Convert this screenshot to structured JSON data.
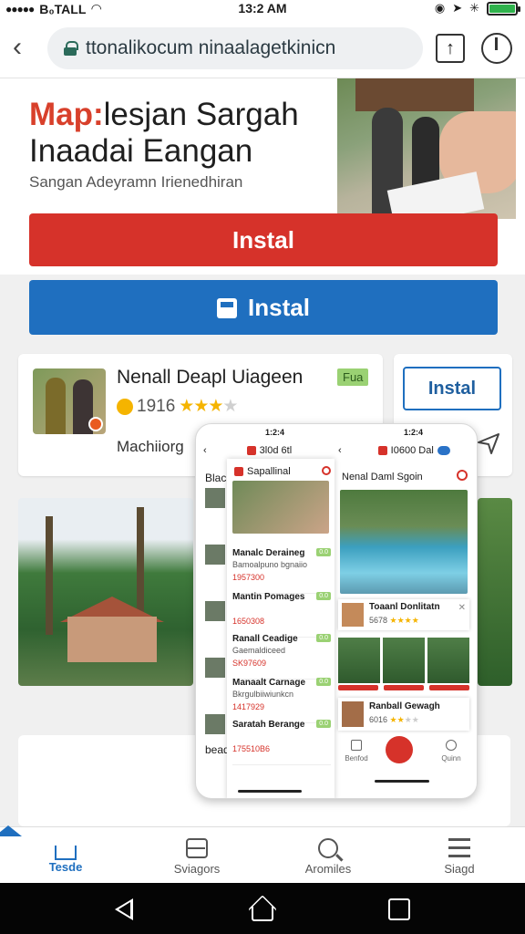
{
  "status_bar": {
    "carrier": "B₀TALL",
    "time": "13:2 AM",
    "battery_level": 1.0,
    "colors": {
      "battery": "#2fb24c"
    }
  },
  "browser": {
    "url": "ttonalikocum ninaalagetkinicn",
    "icons": [
      "back-arrow-icon",
      "lock-icon",
      "share-icon",
      "power-icon"
    ]
  },
  "hero": {
    "title_accent": "Map:",
    "title_rest_line1": "lesjan Sargah",
    "title_line2": "Inaadai Eangan",
    "subtitle": "Sangan Adeyramn Irienedhiran"
  },
  "buttons": {
    "install_red": "Instal",
    "install_blue": "Instal",
    "install_outline": "Instal"
  },
  "app_card": {
    "name": "Nenall Deapl Uiageen",
    "badge": "Fua",
    "rating_text": "1916",
    "rating_stars": 3,
    "developer": "Machiiorg"
  },
  "mockup": {
    "left_time": "1:2:4",
    "right_time": "1:2:4",
    "left_bar_title": "3l0d 6tl",
    "right_bar_title": "I0600 Dal",
    "bg_label_top": "Blac",
    "bg_label_bottom": "bead",
    "left_header": "Sapallinal",
    "list": [
      {
        "name": "Manalc Deraineg",
        "sub": "Bamoalpuno bgnaiio",
        "num": "1957300",
        "tag": "0.0"
      },
      {
        "name": "Mantin Pomages",
        "sub": "",
        "num": "1650308",
        "tag": "0.0"
      },
      {
        "name": "Ranall Ceadige",
        "sub": "Gaemaldiceed",
        "num": "SK97609",
        "tag": "0.0"
      },
      {
        "name": "Manaalt Carnage",
        "sub": "Bkrgulbiiwiunkcn",
        "num": "1417929",
        "tag": "0.0"
      },
      {
        "name": "Saratah Berange",
        "sub": "",
        "num": "175510B6",
        "tag": "0.0"
      }
    ],
    "right_header": "Nenal Daml Sgoin",
    "card1": {
      "name": "Toaanl Donlitatn",
      "rating": "5678"
    },
    "card2": {
      "name": "Ranball Gewagh",
      "rating": "6016"
    },
    "tabs": [
      "Benfod",
      "",
      "Quinn"
    ]
  },
  "bottom_nav": {
    "items": [
      {
        "label": "Tesde",
        "icon": "home-icon",
        "active": true
      },
      {
        "label": "Sviagors",
        "icon": "box-icon",
        "active": false
      },
      {
        "label": "Aromiles",
        "icon": "search-icon",
        "active": false
      },
      {
        "label": "Siagd",
        "icon": "menu-icon",
        "active": false
      }
    ]
  },
  "colors": {
    "brand_red": "#d6322a",
    "brand_blue": "#1f6fbf",
    "badge_green": "#9ad173",
    "star": "#f5b400"
  }
}
